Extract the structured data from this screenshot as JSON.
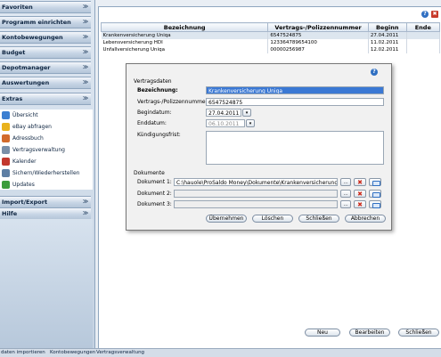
{
  "sidebar": {
    "headers": [
      {
        "label": "Favoriten"
      },
      {
        "label": "Programm einrichten"
      },
      {
        "label": "Kontobewegungen"
      },
      {
        "label": "Budget"
      },
      {
        "label": "Depotmanager"
      },
      {
        "label": "Auswertungen"
      },
      {
        "label": "Extras"
      },
      {
        "label": "Import/Export"
      },
      {
        "label": "Hilfe"
      }
    ],
    "extras_items": [
      {
        "label": "Übersicht",
        "icon": "overview-icon",
        "color": "#3c7fd1"
      },
      {
        "label": "eBay abfragen",
        "icon": "ebay-icon",
        "color": "#e9b21c"
      },
      {
        "label": "Adressbuch",
        "icon": "addressbook-icon",
        "color": "#d26b2c"
      },
      {
        "label": "Vertragsverwaltung",
        "icon": "contract-icon",
        "color": "#7a8fa8"
      },
      {
        "label": "Kalender",
        "icon": "calendar-icon",
        "color": "#c2382e"
      },
      {
        "label": "Sichern/Wiederherstellen",
        "icon": "backup-icon",
        "color": "#5e7fa4"
      },
      {
        "label": "Updates",
        "icon": "update-icon",
        "color": "#3c9c3c"
      }
    ],
    "chevron": "≫"
  },
  "table": {
    "columns": [
      "Bezeichnung",
      "Vertrags-/Polizzennummer",
      "Beginn",
      "Ende"
    ],
    "rows": [
      [
        "Krankenversicherung Uniqa",
        "6547524875",
        "27.04.2011",
        ""
      ],
      [
        "Lebensversicherung HDI",
        "123364789654100",
        "11.02.2011",
        ""
      ],
      [
        "Unfallversicherung Uniqa",
        "00000256987",
        "12.02.2011",
        ""
      ]
    ]
  },
  "dialog": {
    "section_contract": "Vertragsdaten",
    "label_name": "Bezeichnung:",
    "value_name": "Krankenversicherung Uniqa",
    "label_number": "Vertrags-/Polizzennummer:",
    "value_number": "6547524875",
    "label_begin": "Begindatum:",
    "value_begin": "27.04.2011",
    "label_end": "Enddatum:",
    "value_end": "06.10.2011",
    "label_cancel_deadline": "Kündigungsfrist:",
    "section_docs": "Dokumente",
    "doc1_label": "Dokument 1:",
    "doc1_value": "C:\\hauole\\ProSaldo Money\\Dokumente\\Krankenversicherung Uniqa",
    "doc2_label": "Dokument 2:",
    "doc2_value": "",
    "doc3_label": "Dokument 3:",
    "doc3_value": "",
    "btn_take": "Übernehmen",
    "btn_delete": "Löschen",
    "btn_close": "Schließen",
    "btn_cancel": "Abbrechen",
    "dots": "...",
    "delete_mark": "✖"
  },
  "main_buttons": {
    "new": "Neu",
    "edit": "Bearbeiten",
    "close": "Schließen"
  },
  "status": {
    "items": [
      "daten importieren",
      "Kontobewegungen",
      "Vertragsverwaltung"
    ]
  },
  "window": {
    "help": "?",
    "close": "✖"
  }
}
